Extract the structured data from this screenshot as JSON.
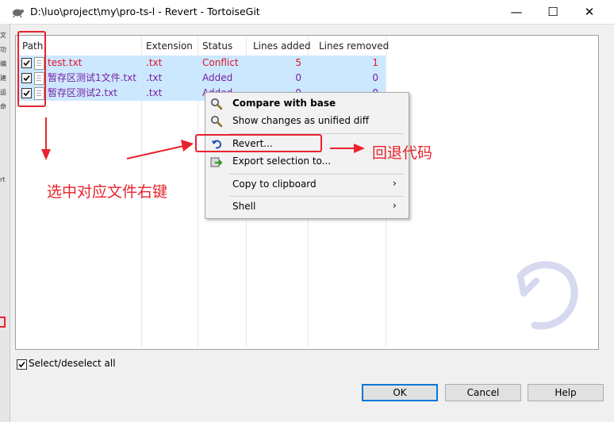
{
  "window": {
    "title": "D:\\luo\\project\\my\\pro-ts-l - Revert - TortoiseGit",
    "minimize_glyph": "—",
    "maximize_glyph": "☐",
    "close_glyph": "✕"
  },
  "left_strip": [
    "文",
    "功",
    "编",
    "建",
    "运",
    "命",
    "rt"
  ],
  "list": {
    "columns": [
      "Path",
      "Extension",
      "Status",
      "Lines added",
      "Lines removed"
    ],
    "rows": [
      {
        "path": "test.txt",
        "extension": ".txt",
        "status": "Conflict",
        "lines_added": "5",
        "lines_removed": "1",
        "checked": true
      },
      {
        "path": "暂存区测试1文件.txt",
        "extension": ".txt",
        "status": "Added",
        "lines_added": "0",
        "lines_removed": "0",
        "checked": true
      },
      {
        "path": "暂存区测试2.txt",
        "extension": ".txt",
        "status": "Added",
        "lines_added": "0",
        "lines_removed": "0",
        "checked": true
      }
    ]
  },
  "context_menu": {
    "items": [
      {
        "label": "Compare with base",
        "icon": "magnifier-icon"
      },
      {
        "label": "Show changes as unified diff",
        "icon": "magnifier-icon"
      },
      {
        "label": "Revert...",
        "icon": "revert-icon"
      },
      {
        "label": "Export selection to...",
        "icon": "export-icon"
      },
      {
        "label": "Copy to clipboard",
        "submenu": true
      },
      {
        "label": "Shell",
        "submenu": true
      }
    ],
    "submenu_glyph": "›"
  },
  "bottom": {
    "select_all_label": "Select/deselect all",
    "select_all_checked": true,
    "ok_label": "OK",
    "cancel_label": "Cancel",
    "help_label": "Help"
  },
  "annotations": {
    "instruction": "选中对应文件右键",
    "revert_note": "回退代码",
    "color": "#e8232d"
  },
  "colors": {
    "selection": "#cce8ff",
    "conflict": "#e0132a",
    "added": "#7a1fa2",
    "default_button_border": "#0078d7"
  }
}
